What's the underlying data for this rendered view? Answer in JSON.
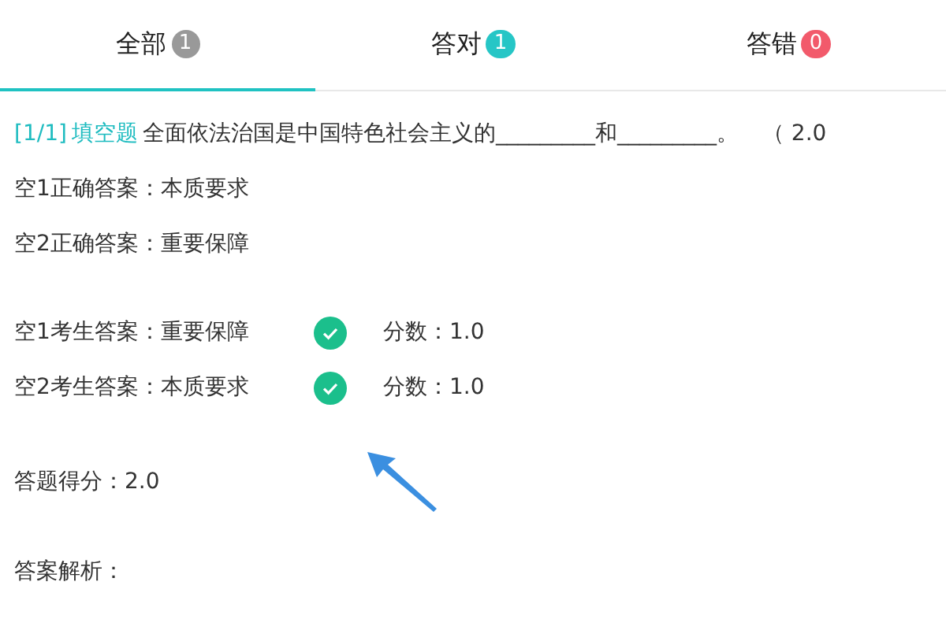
{
  "tabs": [
    {
      "label": "全部",
      "count": "1",
      "color": "#999999",
      "selected": true
    },
    {
      "label": "答对",
      "count": "1",
      "color": "#26c6c6",
      "selected": false
    },
    {
      "label": "答错",
      "count": "0",
      "color": "#f25a6b",
      "selected": false
    }
  ],
  "question": {
    "index": "[1/1]",
    "type": "填空题",
    "text": "全面依法治国是中国特色社会主义的_________和_________。",
    "score": "（ 2.0"
  },
  "correct_answers": [
    "空1正确答案：本质要求",
    "空2正确答案：重要保障"
  ],
  "student_answers": [
    {
      "text": "空1考生答案：重要保障",
      "correct": true,
      "score": "分数：1.0"
    },
    {
      "text": "空2考生答案：本质要求",
      "correct": true,
      "score": "分数：1.0"
    }
  ],
  "total": "答题得分：2.0",
  "analysis": "答案解析："
}
